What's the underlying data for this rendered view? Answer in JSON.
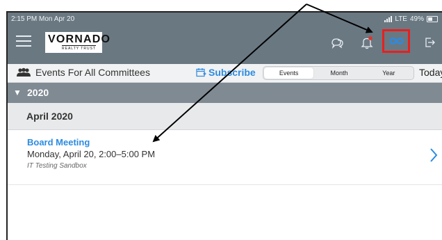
{
  "status_bar": {
    "time": "2:15 PM  Mon Apr 20",
    "network": "LTE",
    "battery": "49%"
  },
  "header": {
    "logo_text": "VORNADO",
    "logo_subtext": "REALTY TRUST"
  },
  "toolbar": {
    "committees_label": "Events For All Committees",
    "subscribe_label": "Subscribe",
    "views": [
      "Events",
      "Month",
      "Year"
    ],
    "active_view": "Events",
    "today_label": "Today"
  },
  "calendar": {
    "year": "2020",
    "month": "April 2020",
    "events": [
      {
        "title": "Board Meeting",
        "datetime": "Monday, April 20, 2:00–5:00 PM",
        "location": "IT Testing Sandbox"
      }
    ]
  },
  "colors": {
    "topbar": "#6a7882",
    "accent": "#2c8be0",
    "highlight": "#e8201e",
    "notification_dot": "#e0342b"
  },
  "icons": [
    "menu-icon",
    "chat-icon",
    "bell-icon",
    "infinity-icon",
    "logout-icon",
    "people-icon",
    "calendar-plus-icon",
    "chevron-right-icon"
  ]
}
